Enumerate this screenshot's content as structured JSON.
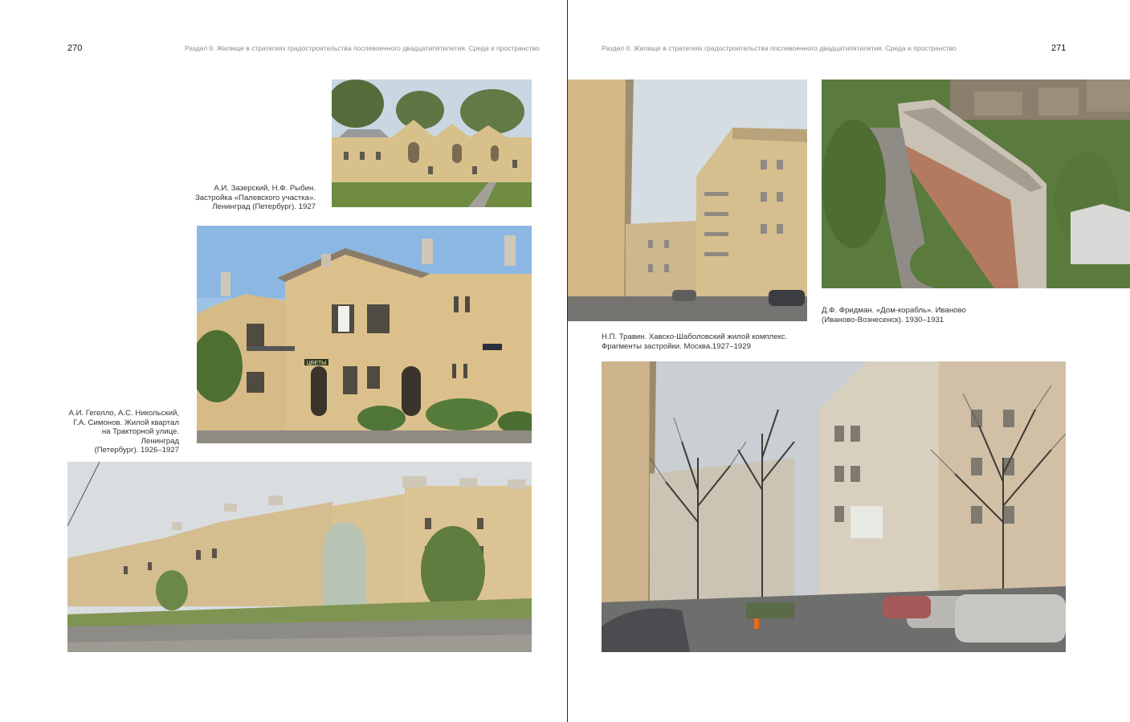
{
  "left_page": {
    "page_number": "270",
    "running_header": "Раздел II.   Жилище в стратегиях градостроительства послевоенного двадцатипятилетия.  Среда и пространство",
    "captions": {
      "zazersky": "А.И. Зазерский, Н.Ф. Рыбин.\nЗастройка «Палевского участка».\nЛенинград (Петербург). 1927",
      "gegello": "А.И. Гегелло, А.С. Никольский,\nГ.А. Симонов. Жилой квартал\nна Тракторной улице. Ленинград\n(Петербург). 1926–1927"
    },
    "photo_text": {
      "shop_sign": "ЦВЕТЫ"
    }
  },
  "right_page": {
    "page_number": "271",
    "running_header": "Раздел II.   Жилище в стратегиях градостроительства послевоенного двадцатипятилетия.  Среда и пространство",
    "captions": {
      "travin": "Н.П. Травин. Хавско-Шаболовский жилой комплекс.\nФрагменты застройки. Москва.1927–1929",
      "fridman": "Д.Ф. Фридман. «Дом-корабль». Иваново\n(Иваново-Вознесенск). 1930–1931"
    }
  },
  "colors": {
    "facade_yellow": "#d9c08e",
    "sky": "#dfe6ea",
    "grass": "#6e8b45",
    "asphalt": "#7a7a78",
    "spine": "#2a2a2a"
  }
}
